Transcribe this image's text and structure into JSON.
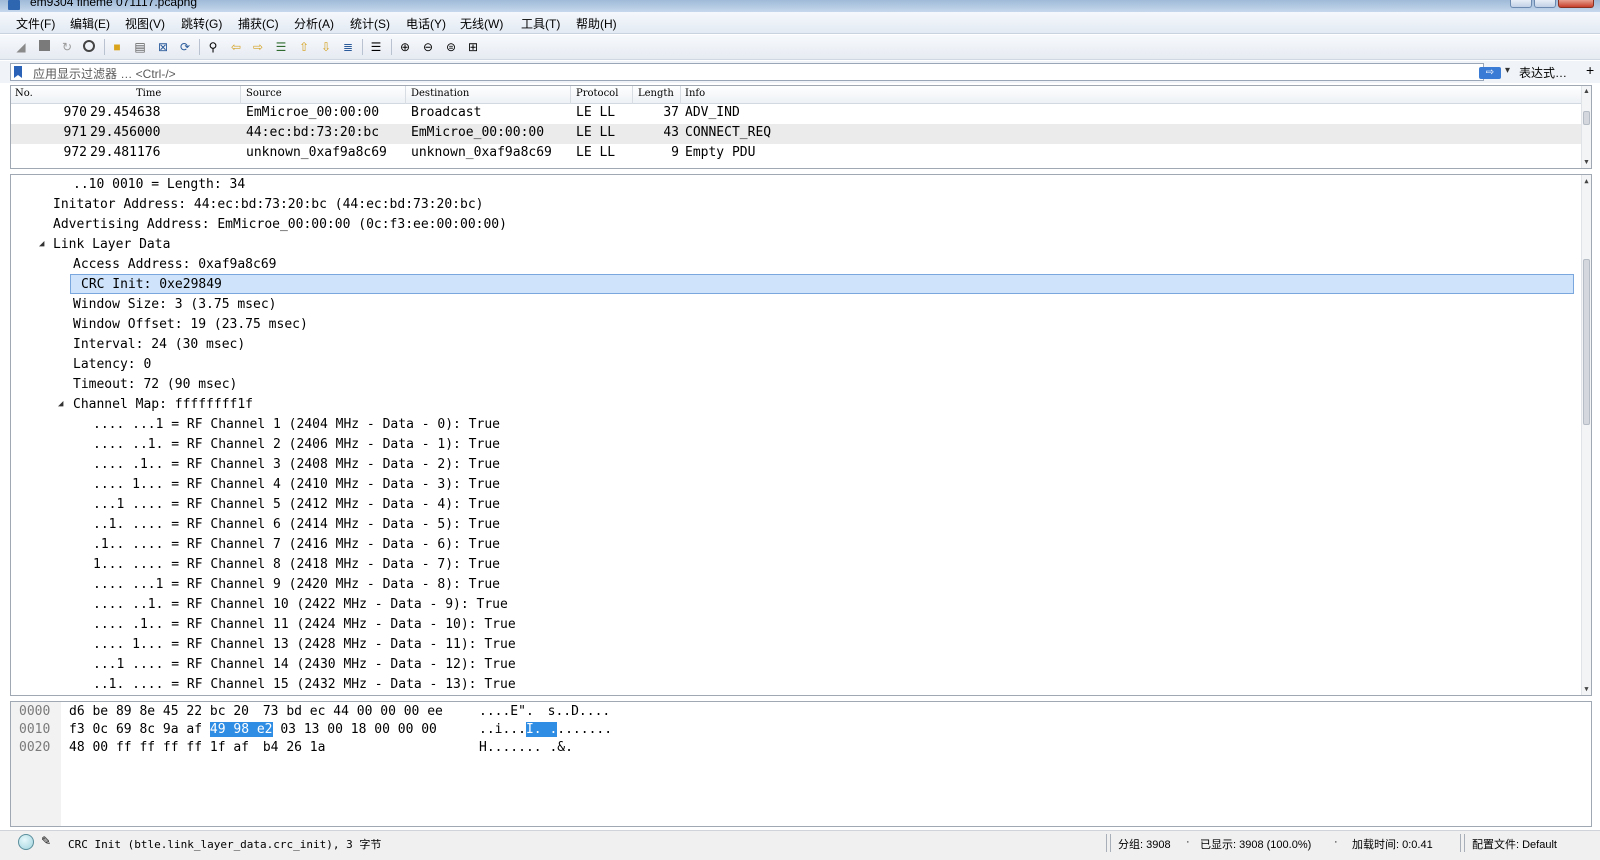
{
  "window": {
    "title": "em9304 fineme 071117.pcapng"
  },
  "menu": [
    "文件(F)",
    "编辑(E)",
    "视图(V)",
    "跳转(G)",
    "捕获(C)",
    "分析(A)",
    "统计(S)",
    "电话(Y)",
    "无线(W)",
    "工具(T)",
    "帮助(H)"
  ],
  "filter": {
    "placeholder": "应用显示过滤器 … <Ctrl-/>",
    "apply_glyph": "⇨",
    "dropdown_glyph": "▾",
    "expression_label": "表达式…",
    "plus_label": "+"
  },
  "packet_list": {
    "columns": [
      "No.",
      "Time",
      "Source",
      "Destination",
      "Protocol",
      "Length",
      "Info"
    ],
    "rows": [
      {
        "no": "970",
        "time": "29.454638",
        "source": "EmMicroe_00:00:00",
        "destination": "Broadcast",
        "protocol": "LE LL",
        "length": "37",
        "info": "ADV_IND"
      },
      {
        "no": "971",
        "time": "29.456000",
        "source": "44:ec:bd:73:20:bc",
        "destination": "EmMicroe_00:00:00",
        "protocol": "LE LL",
        "length": "43",
        "info": "CONNECT_REQ"
      },
      {
        "no": "972",
        "time": "29.481176",
        "source": "unknown_0xaf9a8c69",
        "destination": "unknown_0xaf9a8c69",
        "protocol": "LE LL",
        "length": "9",
        "info": "Empty PDU"
      }
    ]
  },
  "details": {
    "lines": [
      "..10 0010 = Length: 34",
      "Initator Address: 44:ec:bd:73:20:bc (44:ec:bd:73:20:bc)",
      "Advertising Address: EmMicroe_00:00:00 (0c:f3:ee:00:00:00)",
      "Link Layer Data",
      "Access Address: 0xaf9a8c69",
      "CRC Init: 0xe29849",
      "Window Size: 3 (3.75 msec)",
      "Window Offset: 19 (23.75 msec)",
      "Interval: 24 (30 msec)",
      "Latency: 0",
      "Timeout: 72 (90 msec)",
      "Channel Map: ffffffff1f",
      ".... ...1 = RF Channel 1 (2404 MHz - Data - 0): True",
      ".... ..1. = RF Channel 2 (2406 MHz - Data - 1): True",
      ".... .1.. = RF Channel 3 (2408 MHz - Data - 2): True",
      ".... 1... = RF Channel 4 (2410 MHz - Data - 3): True",
      "...1 .... = RF Channel 5 (2412 MHz - Data - 4): True",
      "..1. .... = RF Channel 6 (2414 MHz - Data - 5): True",
      ".1.. .... = RF Channel 7 (2416 MHz - Data - 6): True",
      "1... .... = RF Channel 8 (2418 MHz - Data - 7): True",
      ".... ...1 = RF Channel 9 (2420 MHz - Data - 8): True",
      ".... ..1. = RF Channel 10 (2422 MHz - Data - 9): True",
      ".... .1.. = RF Channel 11 (2424 MHz - Data - 10): True",
      ".... 1... = RF Channel 13 (2428 MHz - Data - 11): True",
      "...1 .... = RF Channel 14 (2430 MHz - Data - 12): True",
      "..1. .... = RF Channel 15 (2432 MHz - Data - 13): True"
    ],
    "expanders": {
      "link_layer": "◢",
      "channel_map": "◢"
    }
  },
  "bytes": {
    "rows": [
      {
        "offset": "0000",
        "hex_a": "d6 be 89 8e 45 22 bc 20",
        "hex_hl": "",
        "hex_b": "73 bd ec 44 00 00 00 ee",
        "ascii_a": "....E\".",
        "ascii_hl": "",
        "ascii_b": "s..D...."
      },
      {
        "offset": "0010",
        "hex_a": "f3 0c 69 8c 9a af",
        "hex_hl": "49 98  e2",
        "hex_b": "03 13 00 18 00 00 00",
        "ascii_a": "..i...",
        "ascii_hl": "I. .",
        "ascii_b": "......."
      },
      {
        "offset": "0020",
        "hex_a": "48 00 ff ff ff ff 1f af",
        "hex_hl": "",
        "hex_b": "b4 26 1a",
        "ascii_a": "H.......",
        "ascii_hl": "",
        "ascii_b": ".&."
      }
    ]
  },
  "status": {
    "field_info": "CRC Init (btle.link_layer_data.crc_init), 3 字节",
    "packets": "分组: 3908",
    "displayed": "已显示: 3908 (100.0%)",
    "load_time": "加载时间: 0:0.41",
    "profile": "配置文件: Default"
  }
}
